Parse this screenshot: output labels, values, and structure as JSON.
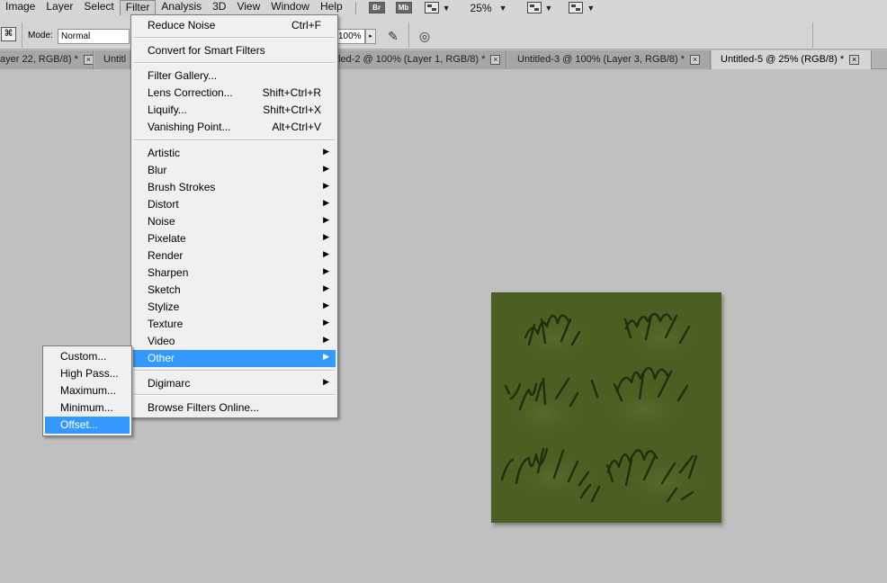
{
  "menubar": {
    "items": [
      {
        "label": "Image"
      },
      {
        "label": "Layer"
      },
      {
        "label": "Select"
      },
      {
        "label": "Filter"
      },
      {
        "label": "Analysis"
      },
      {
        "label": "3D"
      },
      {
        "label": "View"
      },
      {
        "label": "Window"
      },
      {
        "label": "Help"
      }
    ],
    "bridge_label": "Br",
    "minibridge_label": "Mb",
    "zoom": "25%",
    "caret": "▼"
  },
  "options": {
    "mode_label": "Mode:",
    "mode_value": "Normal",
    "flow_value": "100%",
    "arrow": "▸"
  },
  "tabs": [
    {
      "label": "ayer 22, RGB/8) *",
      "close": "×"
    },
    {
      "label": "Untitl",
      "close": ""
    },
    {
      "label": "led-2 @ 100% (Layer 1, RGB/8) *",
      "close": "×"
    },
    {
      "label": "Untitled-3 @ 100% (Layer 3, RGB/8) *",
      "close": "×"
    },
    {
      "label": "Untitled-5 @ 25% (RGB/8) *",
      "close": "×"
    }
  ],
  "filter_menu": {
    "reduce_noise": {
      "label": "Reduce Noise",
      "shortcut": "Ctrl+F"
    },
    "smart_filters": {
      "label": "Convert for Smart Filters"
    },
    "gallery": {
      "label": "Filter Gallery..."
    },
    "lens": {
      "label": "Lens Correction...",
      "shortcut": "Shift+Ctrl+R"
    },
    "liquify": {
      "label": "Liquify...",
      "shortcut": "Shift+Ctrl+X"
    },
    "vanishing": {
      "label": "Vanishing Point...",
      "shortcut": "Alt+Ctrl+V"
    },
    "categories": [
      {
        "label": "Artistic"
      },
      {
        "label": "Blur"
      },
      {
        "label": "Brush Strokes"
      },
      {
        "label": "Distort"
      },
      {
        "label": "Noise"
      },
      {
        "label": "Pixelate"
      },
      {
        "label": "Render"
      },
      {
        "label": "Sharpen"
      },
      {
        "label": "Sketch"
      },
      {
        "label": "Stylize"
      },
      {
        "label": "Texture"
      },
      {
        "label": "Video"
      },
      {
        "label": "Other"
      }
    ],
    "digimarc": {
      "label": "Digimarc"
    },
    "browse": {
      "label": "Browse Filters Online..."
    },
    "arrow": "▶"
  },
  "other_submenu": {
    "items": [
      {
        "label": "Custom..."
      },
      {
        "label": "High Pass..."
      },
      {
        "label": "Maximum..."
      },
      {
        "label": "Minimum..."
      },
      {
        "label": "Offset..."
      }
    ]
  },
  "colors": {
    "highlight": "#3399ff",
    "canvas_fill": "#4a5e22",
    "stroke": "#1c2a0c"
  }
}
